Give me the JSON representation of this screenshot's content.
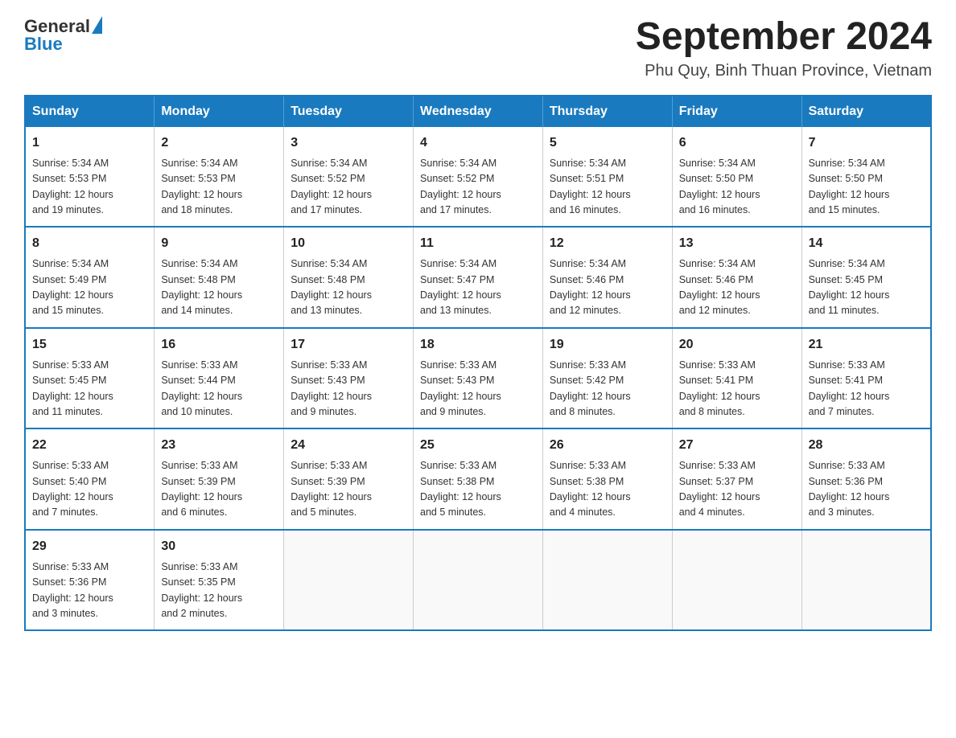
{
  "logo": {
    "general": "General",
    "blue": "Blue"
  },
  "title": {
    "month_year": "September 2024",
    "location": "Phu Quy, Binh Thuan Province, Vietnam"
  },
  "weekdays": [
    "Sunday",
    "Monday",
    "Tuesday",
    "Wednesday",
    "Thursday",
    "Friday",
    "Saturday"
  ],
  "weeks": [
    [
      {
        "day": "1",
        "sunrise": "5:34 AM",
        "sunset": "5:53 PM",
        "daylight": "12 hours and 19 minutes."
      },
      {
        "day": "2",
        "sunrise": "5:34 AM",
        "sunset": "5:53 PM",
        "daylight": "12 hours and 18 minutes."
      },
      {
        "day": "3",
        "sunrise": "5:34 AM",
        "sunset": "5:52 PM",
        "daylight": "12 hours and 17 minutes."
      },
      {
        "day": "4",
        "sunrise": "5:34 AM",
        "sunset": "5:52 PM",
        "daylight": "12 hours and 17 minutes."
      },
      {
        "day": "5",
        "sunrise": "5:34 AM",
        "sunset": "5:51 PM",
        "daylight": "12 hours and 16 minutes."
      },
      {
        "day": "6",
        "sunrise": "5:34 AM",
        "sunset": "5:50 PM",
        "daylight": "12 hours and 16 minutes."
      },
      {
        "day": "7",
        "sunrise": "5:34 AM",
        "sunset": "5:50 PM",
        "daylight": "12 hours and 15 minutes."
      }
    ],
    [
      {
        "day": "8",
        "sunrise": "5:34 AM",
        "sunset": "5:49 PM",
        "daylight": "12 hours and 15 minutes."
      },
      {
        "day": "9",
        "sunrise": "5:34 AM",
        "sunset": "5:48 PM",
        "daylight": "12 hours and 14 minutes."
      },
      {
        "day": "10",
        "sunrise": "5:34 AM",
        "sunset": "5:48 PM",
        "daylight": "12 hours and 13 minutes."
      },
      {
        "day": "11",
        "sunrise": "5:34 AM",
        "sunset": "5:47 PM",
        "daylight": "12 hours and 13 minutes."
      },
      {
        "day": "12",
        "sunrise": "5:34 AM",
        "sunset": "5:46 PM",
        "daylight": "12 hours and 12 minutes."
      },
      {
        "day": "13",
        "sunrise": "5:34 AM",
        "sunset": "5:46 PM",
        "daylight": "12 hours and 12 minutes."
      },
      {
        "day": "14",
        "sunrise": "5:34 AM",
        "sunset": "5:45 PM",
        "daylight": "12 hours and 11 minutes."
      }
    ],
    [
      {
        "day": "15",
        "sunrise": "5:33 AM",
        "sunset": "5:45 PM",
        "daylight": "12 hours and 11 minutes."
      },
      {
        "day": "16",
        "sunrise": "5:33 AM",
        "sunset": "5:44 PM",
        "daylight": "12 hours and 10 minutes."
      },
      {
        "day": "17",
        "sunrise": "5:33 AM",
        "sunset": "5:43 PM",
        "daylight": "12 hours and 9 minutes."
      },
      {
        "day": "18",
        "sunrise": "5:33 AM",
        "sunset": "5:43 PM",
        "daylight": "12 hours and 9 minutes."
      },
      {
        "day": "19",
        "sunrise": "5:33 AM",
        "sunset": "5:42 PM",
        "daylight": "12 hours and 8 minutes."
      },
      {
        "day": "20",
        "sunrise": "5:33 AM",
        "sunset": "5:41 PM",
        "daylight": "12 hours and 8 minutes."
      },
      {
        "day": "21",
        "sunrise": "5:33 AM",
        "sunset": "5:41 PM",
        "daylight": "12 hours and 7 minutes."
      }
    ],
    [
      {
        "day": "22",
        "sunrise": "5:33 AM",
        "sunset": "5:40 PM",
        "daylight": "12 hours and 7 minutes."
      },
      {
        "day": "23",
        "sunrise": "5:33 AM",
        "sunset": "5:39 PM",
        "daylight": "12 hours and 6 minutes."
      },
      {
        "day": "24",
        "sunrise": "5:33 AM",
        "sunset": "5:39 PM",
        "daylight": "12 hours and 5 minutes."
      },
      {
        "day": "25",
        "sunrise": "5:33 AM",
        "sunset": "5:38 PM",
        "daylight": "12 hours and 5 minutes."
      },
      {
        "day": "26",
        "sunrise": "5:33 AM",
        "sunset": "5:38 PM",
        "daylight": "12 hours and 4 minutes."
      },
      {
        "day": "27",
        "sunrise": "5:33 AM",
        "sunset": "5:37 PM",
        "daylight": "12 hours and 4 minutes."
      },
      {
        "day": "28",
        "sunrise": "5:33 AM",
        "sunset": "5:36 PM",
        "daylight": "12 hours and 3 minutes."
      }
    ],
    [
      {
        "day": "29",
        "sunrise": "5:33 AM",
        "sunset": "5:36 PM",
        "daylight": "12 hours and 3 minutes."
      },
      {
        "day": "30",
        "sunrise": "5:33 AM",
        "sunset": "5:35 PM",
        "daylight": "12 hours and 2 minutes."
      },
      null,
      null,
      null,
      null,
      null
    ]
  ],
  "labels": {
    "sunrise": "Sunrise:",
    "sunset": "Sunset:",
    "daylight": "Daylight:"
  }
}
